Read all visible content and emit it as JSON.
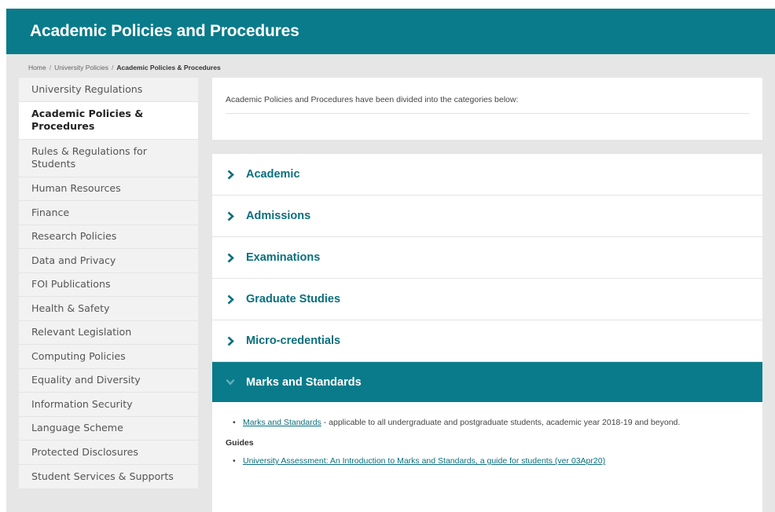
{
  "header": {
    "title": "Academic Policies and Procedures"
  },
  "breadcrumb": {
    "items": [
      "Home",
      "University Policies"
    ],
    "separator": "/",
    "current": "Academic Policies & Procedures"
  },
  "sidebar": {
    "items": [
      {
        "label": "University Regulations"
      },
      {
        "label": "Academic Policies & Procedures",
        "active": true
      },
      {
        "label": "Rules & Regulations for Students"
      },
      {
        "label": "Human Resources"
      },
      {
        "label": "Finance"
      },
      {
        "label": "Research Policies"
      },
      {
        "label": "Data and Privacy"
      },
      {
        "label": "FOI Publications"
      },
      {
        "label": "Health & Safety"
      },
      {
        "label": "Relevant Legislation"
      },
      {
        "label": "Computing Policies"
      },
      {
        "label": "Equality and Diversity"
      },
      {
        "label": "Information Security"
      },
      {
        "label": "Language Scheme"
      },
      {
        "label": "Protected Disclosures"
      },
      {
        "label": "Student Services & Supports"
      }
    ]
  },
  "intro": {
    "text": "Academic Policies and Procedures have been divided into the categories below:"
  },
  "accordion": {
    "items": [
      {
        "label": "Academic"
      },
      {
        "label": "Admissions"
      },
      {
        "label": "Examinations"
      },
      {
        "label": "Graduate Studies"
      },
      {
        "label": "Micro-credentials"
      },
      {
        "label": "Marks and Standards",
        "open": true
      }
    ],
    "open_section": {
      "link1": "Marks and Standards",
      "link1_desc": " - applicable to all undergraduate and postgraduate students, academic year 2018-19 and beyond.",
      "guides_title": "Guides",
      "link2": "University Assessment: An Introduction to Marks and Standards, a guide for students (ver 03Apr20)"
    }
  },
  "colors": {
    "brand": "#0a7b8a",
    "link": "#0a6f7d",
    "background": "#e6e6e6"
  }
}
